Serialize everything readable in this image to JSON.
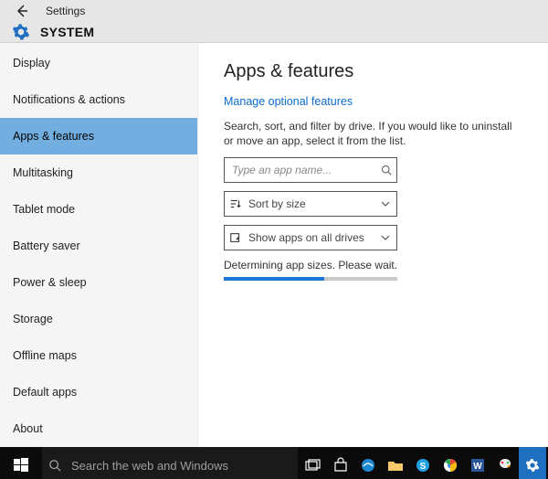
{
  "titlebar": {
    "title": "Settings"
  },
  "header": {
    "label": "SYSTEM"
  },
  "sidebar": {
    "items": [
      {
        "label": "Display"
      },
      {
        "label": "Notifications & actions"
      },
      {
        "label": "Apps & features"
      },
      {
        "label": "Multitasking"
      },
      {
        "label": "Tablet mode"
      },
      {
        "label": "Battery saver"
      },
      {
        "label": "Power & sleep"
      },
      {
        "label": "Storage"
      },
      {
        "label": "Offline maps"
      },
      {
        "label": "Default apps"
      },
      {
        "label": "About"
      }
    ],
    "selected_index": 2
  },
  "main": {
    "heading": "Apps & features",
    "link": "Manage optional features",
    "description": "Search, sort, and filter by drive. If you would like to uninstall or move an app, select it from the list.",
    "search_placeholder": "Type an app name...",
    "sort_label": "Sort by size",
    "drive_label": "Show apps on all drives",
    "status": "Determining app sizes. Please wait.",
    "progress_percent": 58
  },
  "taskbar": {
    "search_placeholder": "Search the web and Windows"
  }
}
